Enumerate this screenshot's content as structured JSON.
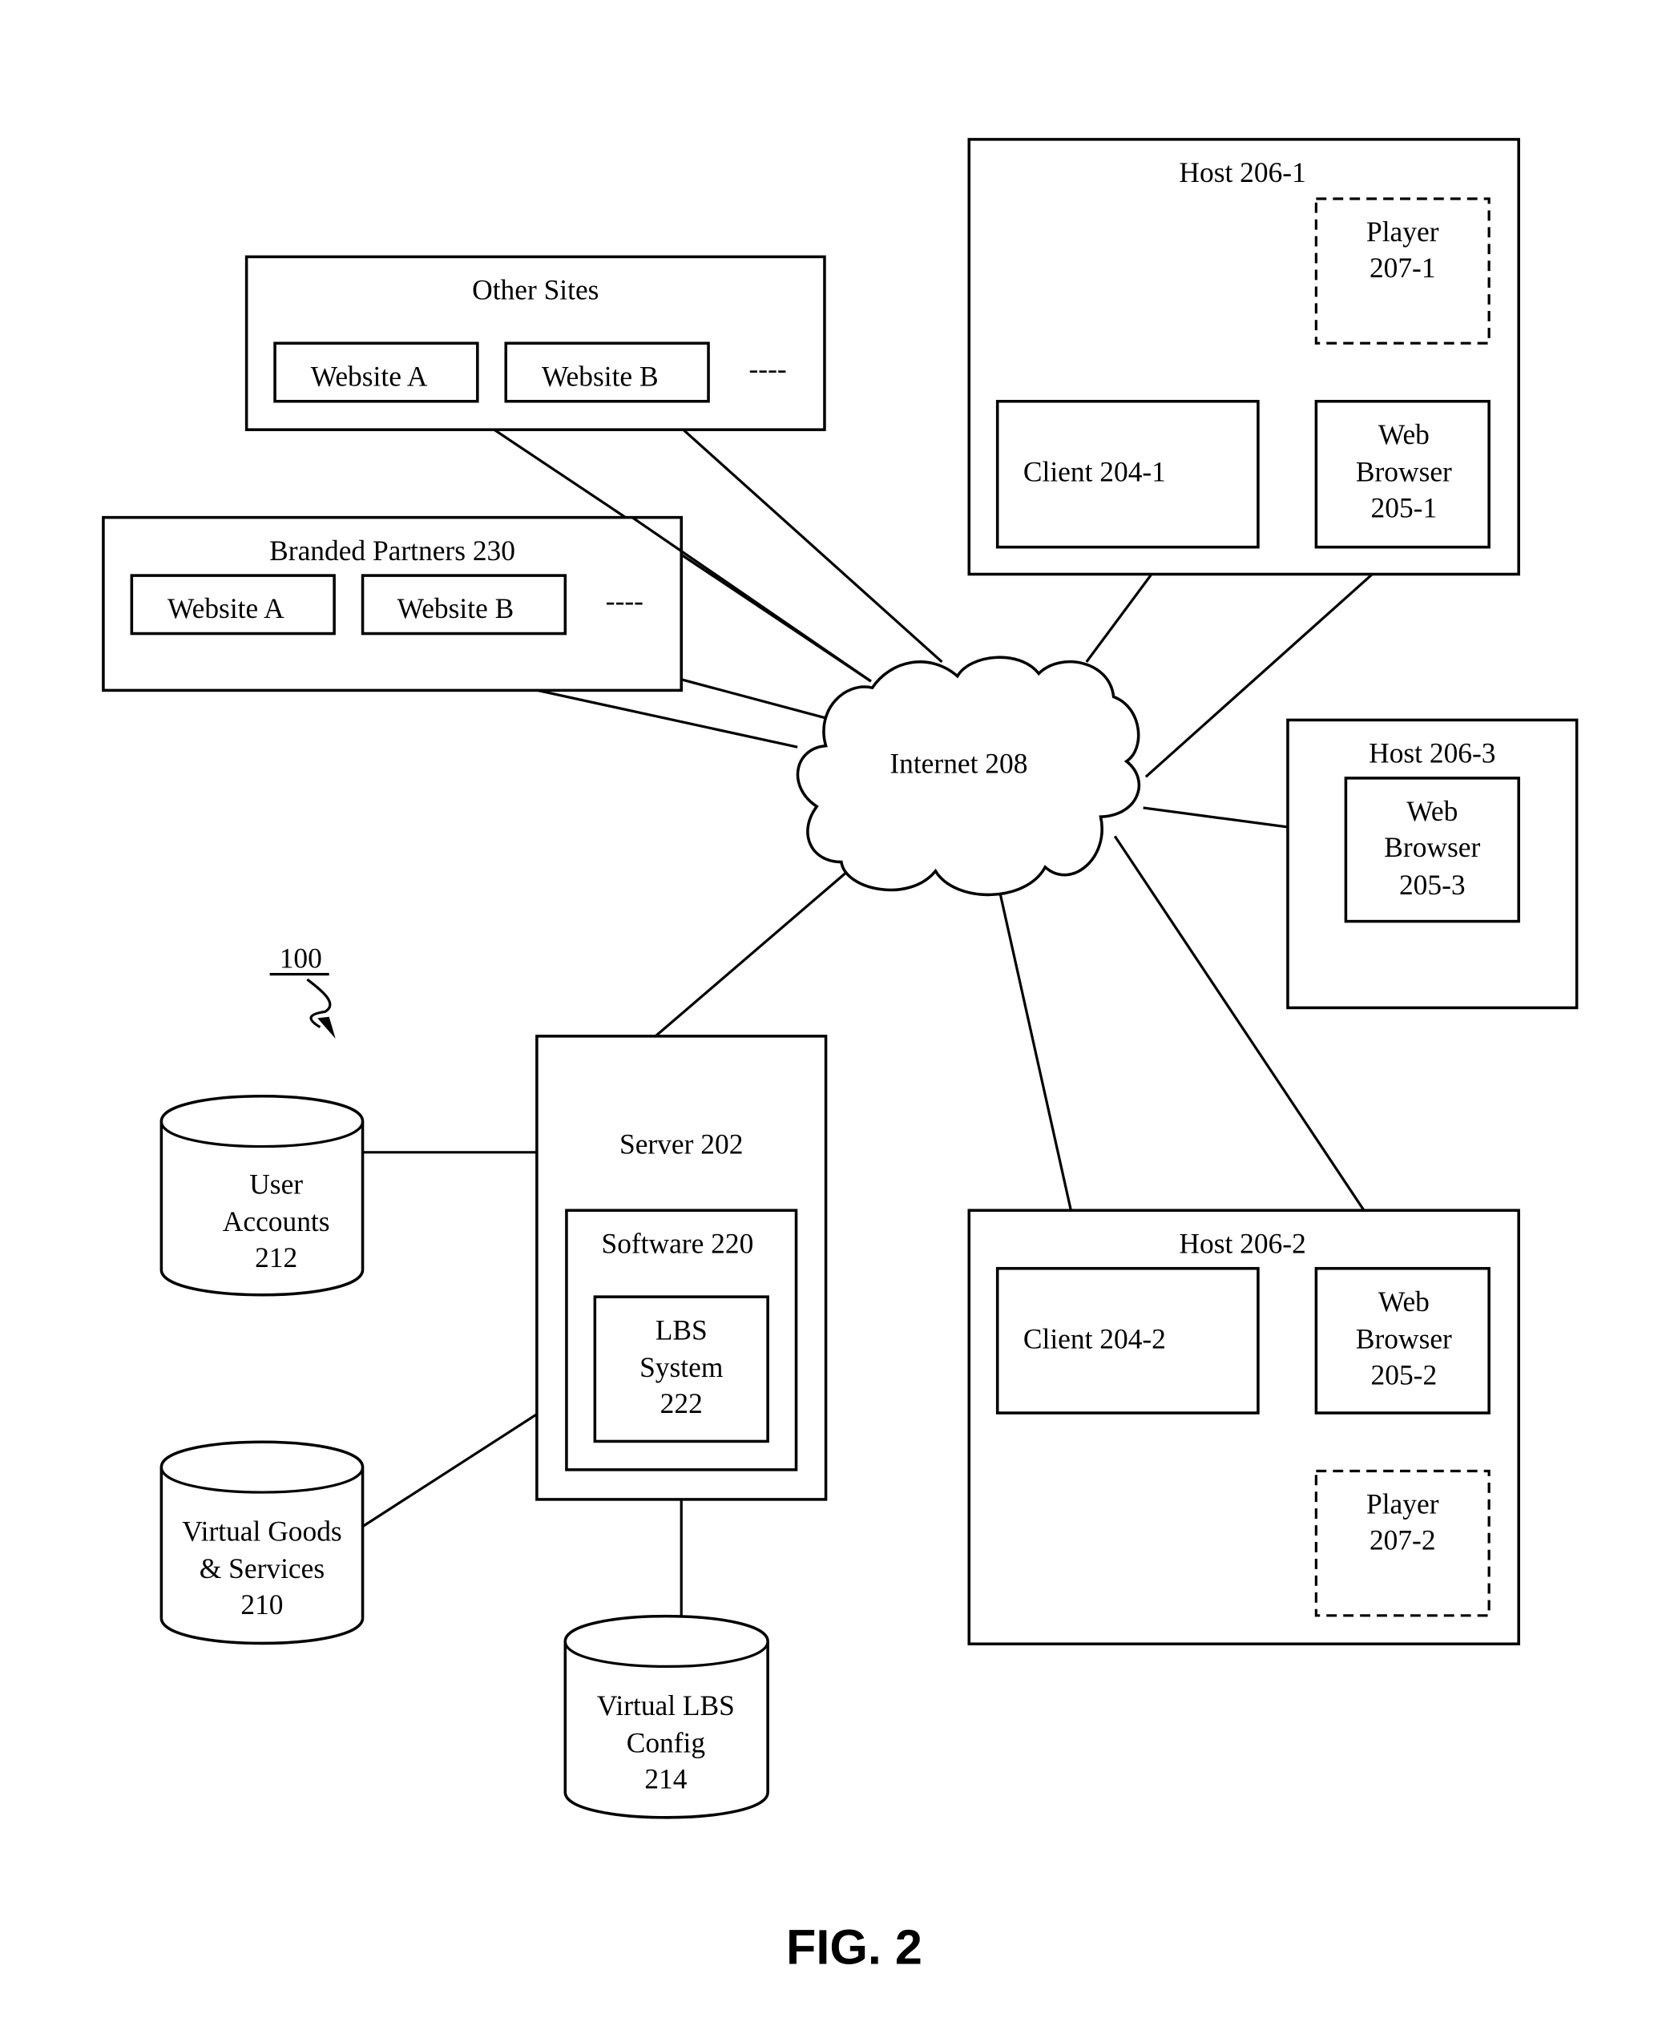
{
  "figure_label": "FIG. 2",
  "reference_numeral": "100",
  "internet": {
    "label": "Internet 208"
  },
  "other_sites": {
    "title": "Other Sites",
    "sites": [
      "Website A",
      "Website B"
    ],
    "ellipsis": "----"
  },
  "branded_partners": {
    "title": "Branded Partners 230",
    "sites": [
      "Website A",
      "Website B"
    ],
    "ellipsis": "----"
  },
  "host_1": {
    "title": "Host 206-1",
    "player": [
      "Player",
      "207-1"
    ],
    "client": "Client 204-1",
    "browser": [
      "Web",
      "Browser",
      "205-1"
    ]
  },
  "host_3": {
    "title": "Host 206-3",
    "browser": [
      "Web",
      "Browser",
      "205-3"
    ]
  },
  "host_2": {
    "title": "Host 206-2",
    "client": "Client 204-2",
    "browser": [
      "Web",
      "Browser",
      "205-2"
    ],
    "player": [
      "Player",
      "207-2"
    ]
  },
  "server": {
    "title": "Server 202",
    "software": "Software 220",
    "lbs": [
      "LBS",
      "System",
      "222"
    ]
  },
  "databases": {
    "user_accounts": [
      "User",
      "Accounts",
      "212"
    ],
    "virtual_goods": [
      "Virtual Goods",
      "& Services",
      "210"
    ],
    "virtual_lbs_config": [
      "Virtual LBS",
      "Config",
      "214"
    ]
  }
}
